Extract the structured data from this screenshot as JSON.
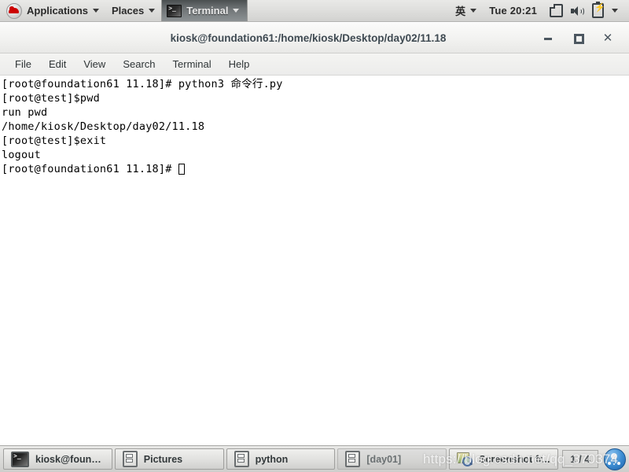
{
  "top_panel": {
    "applications_label": "Applications",
    "places_label": "Places",
    "window_item_label": "Terminal",
    "input_method_label": "英",
    "clock": "Tue 20:21"
  },
  "window": {
    "title": "kiosk@foundation61:/home/kiosk/Desktop/day02/11.18",
    "controls": {
      "minimize": "–",
      "maximize": "□",
      "close": "✕"
    },
    "menu": [
      {
        "label": "File"
      },
      {
        "label": "Edit"
      },
      {
        "label": "View"
      },
      {
        "label": "Search"
      },
      {
        "label": "Terminal"
      },
      {
        "label": "Help"
      }
    ]
  },
  "terminal": {
    "lines": [
      "[root@foundation61 11.18]# python3 命令行.py",
      "[root@test]$pwd",
      "run pwd",
      "/home/kiosk/Desktop/day02/11.18",
      "[root@test]$exit",
      "logout"
    ],
    "prompt": "[root@foundation61 11.18]# "
  },
  "taskbar": {
    "items": [
      {
        "label": "kiosk@founda...",
        "icon": "terminal-icon",
        "active": true
      },
      {
        "label": "Pictures",
        "icon": "files-icon",
        "active": true
      },
      {
        "label": "python",
        "icon": "files-icon",
        "active": true
      },
      {
        "label": "[day01]",
        "icon": "files-icon",
        "active": false
      },
      {
        "label": "Screenshot fr...",
        "icon": "screenshot-icon",
        "active": true
      }
    ],
    "workspace_indicator": "1 / 4"
  },
  "watermark": {
    "text": "https://blog.csdn.net/qq_370374"
  },
  "colors": {
    "panel_bg": "#dededc",
    "terminal_bg": "#ffffff",
    "terminal_fg": "#000000",
    "title_fg": "#3f4a52",
    "accent_blue": "#3f8fd4",
    "redhat_red": "#cc0000"
  }
}
